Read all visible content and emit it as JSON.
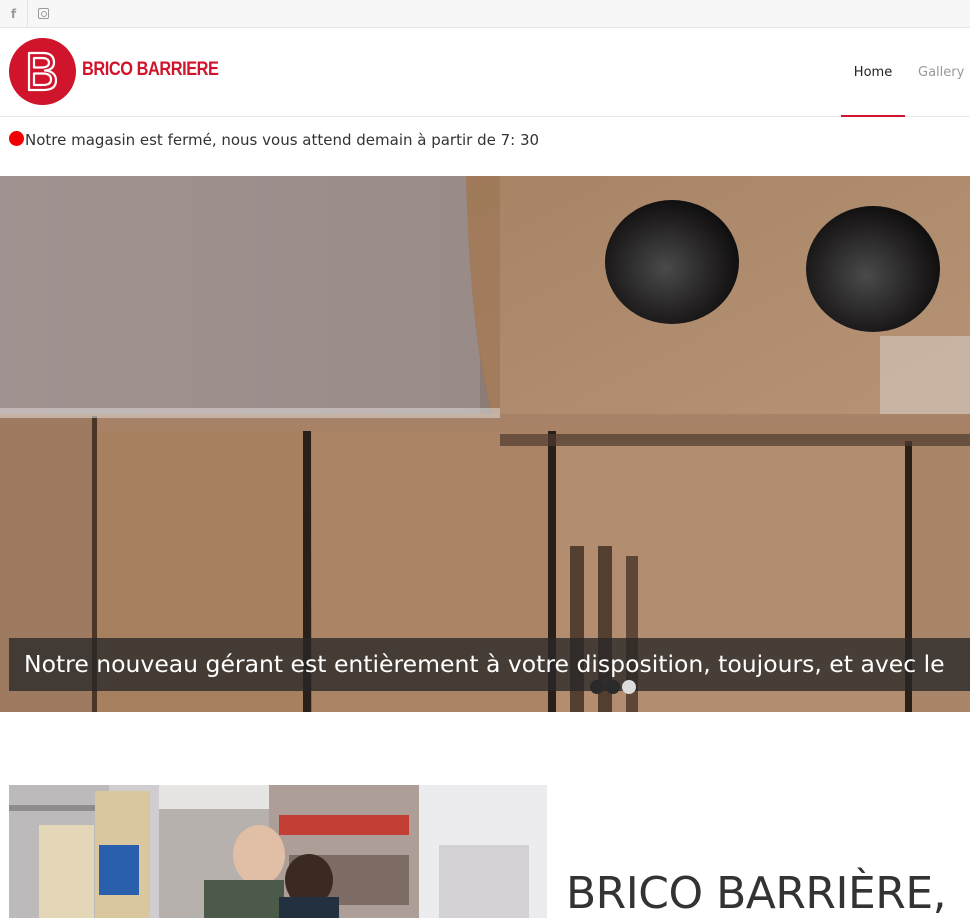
{
  "social": {
    "facebook_icon": "facebook-icon",
    "instagram_icon": "instagram-icon"
  },
  "header": {
    "brand_name": "BRICO BARRIERE",
    "nav": [
      {
        "label": "Home",
        "active": true
      },
      {
        "label": "Gallery",
        "active": false
      }
    ],
    "accent_color": "#d0142c"
  },
  "notice": {
    "text": "Notre magasin est fermé, nous vous attend demain à partir de 7: 30",
    "status_color": "#f00000"
  },
  "hero": {
    "caption": "Notre nouveau gérant est entièrement à votre disposition, toujours, et avec le",
    "slides_count": 3,
    "active_slide": 3
  },
  "about": {
    "title": "BRICO BARRIÈRE,"
  }
}
